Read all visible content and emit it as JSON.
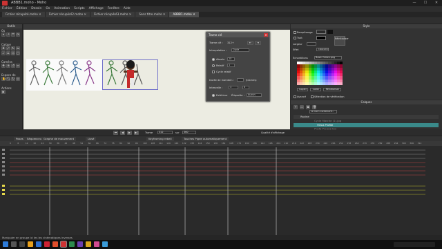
{
  "window": {
    "title": "ABBB1.moho - Moho",
    "minimize": "—",
    "maximize": "☐",
    "close": "✕"
  },
  "menu": [
    "Fichier",
    "Édition",
    "Dessin",
    "Os",
    "Animation",
    "Scripts",
    "Affichage",
    "Fenêtre",
    "Aide"
  ],
  "doc_tabs": [
    {
      "label": "Fichier récupéré.moho",
      "active": false
    },
    {
      "label": "Fichier récupéré2.moho",
      "active": false
    },
    {
      "label": "Fichier récupéré3.moho",
      "active": false
    },
    {
      "label": "Sans titre.moho",
      "active": false
    },
    {
      "label": "ABBB1.moho",
      "active": true
    }
  ],
  "left_panel": {
    "header": "Outils",
    "sections": [
      "Os",
      "Calque",
      "Caméra",
      "Espace de travail",
      "Actions"
    ]
  },
  "dialog": {
    "title": "Trame clé",
    "frame_label": "Trame clé :",
    "frame_value": "312+",
    "interpolation_label": "Interpolation :",
    "interpolation_value": "Cycle",
    "absolute_label": "Absolu",
    "absolute_value": "25",
    "relative_label": "Relatif",
    "relative_value": "1",
    "cycle_label": "Cycle relatif",
    "duration_label": "Durée de maintien :",
    "duration_unit": "(trames)",
    "interval_label": "Intervalle :",
    "interval_value": "1",
    "interval_value2": "0",
    "ease_label": "Extérieur",
    "label_label": "Étiquette :",
    "label_value": "Aucun"
  },
  "style_panel": {
    "header": "Style",
    "fill_label": "Remplissage",
    "stroke_label": "Trait",
    "width_label": "Largeur",
    "effect_label": "Effet",
    "effect_value": "<aucun>",
    "reset_label": "Réinitialiser",
    "brush_label": "Pinceau",
    "swatches_label": "Échantillons",
    "swatches_value": "Basic Colors.png",
    "copy_button": "Copier",
    "paste_button": "Coller",
    "reset_button": "Réinitialiser",
    "advanced_label": "Avancé",
    "checkbox_label": "Sélection de vérification"
  },
  "layers_panel": {
    "header": "Calques",
    "root_label": "Racine",
    "switch_label": "Le nom contenant...",
    "rows": [
      {
        "name": "Cycle Marche (1).jpg",
        "selected": false
      },
      {
        "name": "VOLA Profile",
        "selected": true
      },
      {
        "name": "Cycle Course.jpg",
        "selected": false
      },
      {
        "name": "sol",
        "selected": false
      }
    ]
  },
  "controls": {
    "frame_label": "Trame",
    "frame_value": "312",
    "of_label": "sur",
    "total_value": "360",
    "quality_label": "Qualité d'affichage"
  },
  "timeline": {
    "tabs": [
      "Poses",
      "Séquenceur",
      "Graphe de mouvement",
      "Lissé",
      "Keyframing rebell",
      "Touches Pigee automatiquement"
    ],
    "frame_ticks": [
      "0",
      "6",
      "12",
      "18",
      "24",
      "30",
      "36",
      "42",
      "48",
      "54",
      "60",
      "66",
      "72",
      "78",
      "84",
      "90",
      "96",
      "102",
      "108",
      "114",
      "120",
      "126",
      "132",
      "138",
      "144",
      "150",
      "156",
      "162",
      "168",
      "174",
      "180",
      "186",
      "192",
      "198",
      "204",
      "210",
      "216",
      "222",
      "228",
      "234",
      "240",
      "246",
      "252",
      "258",
      "264",
      "270",
      "276",
      "282",
      "288",
      "294",
      "300",
      "306",
      "312"
    ]
  },
  "status": {
    "text": "Manipuler en groupe ici les les cinématiques inverses"
  },
  "colors": {
    "accent_selected_row": "#3a8a8a",
    "dialog_close": "#cc3333",
    "canvas_bg": "#ecece2"
  }
}
